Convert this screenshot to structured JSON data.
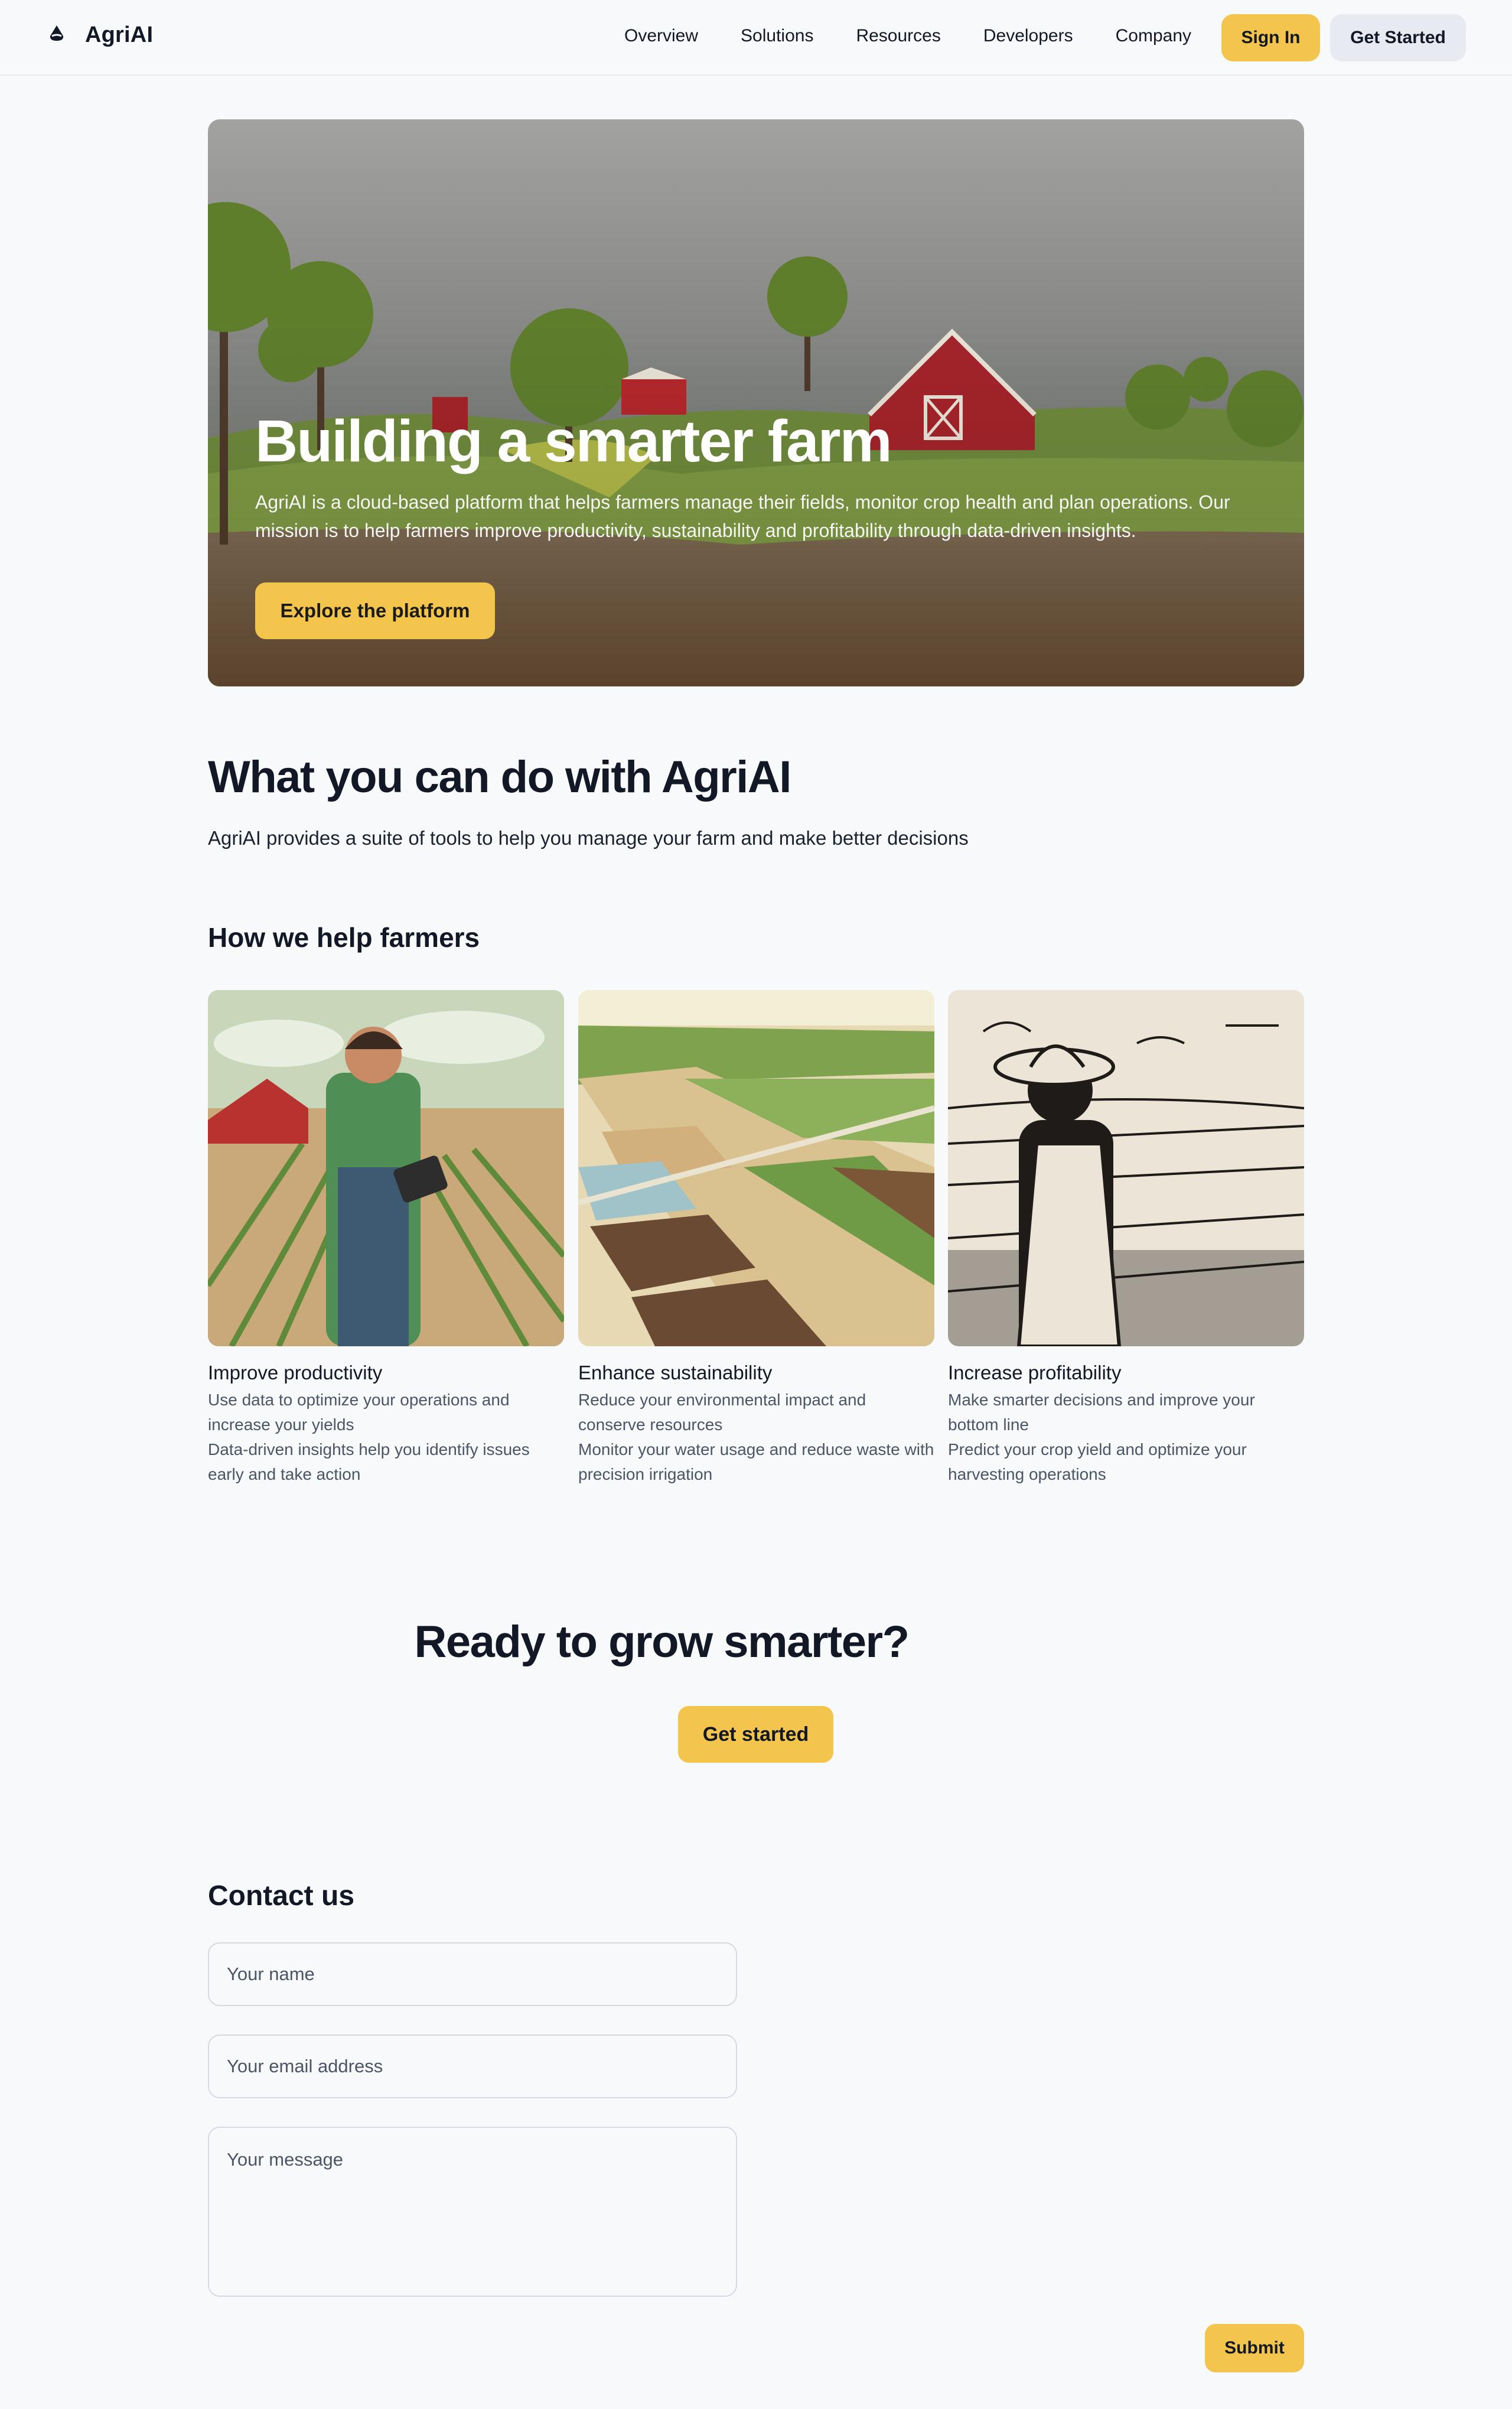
{
  "brand": {
    "name": "AgriAI",
    "logo_icon": "sprout-drop-icon"
  },
  "nav": {
    "links": [
      "Overview",
      "Solutions",
      "Resources",
      "Developers",
      "Company"
    ],
    "sign_in": "Sign In",
    "get_started": "Get Started"
  },
  "hero": {
    "title": "Building a smarter farm",
    "subtitle": "AgriAI is a cloud-based platform that helps farmers manage their fields, monitor crop health and plan operations. Our mission is to help farmers improve productivity, sustainability and profitability through data-driven insights.",
    "button": "Explore the platform"
  },
  "features": {
    "title": "What you can do with AgriAI",
    "lead": "AgriAI provides a suite of tools to help you manage your farm and make better decisions",
    "subtitle": "How we help farmers",
    "cards": [
      {
        "title": "Improve productivity",
        "lines": [
          "Use data to optimize your operations and increase your yields",
          "Data-driven insights help you identify issues early and take action"
        ]
      },
      {
        "title": "Enhance sustainability",
        "lines": [
          "Reduce your environmental impact and conserve resources",
          "Monitor your water usage and reduce waste with precision irrigation"
        ]
      },
      {
        "title": "Increase profitability",
        "lines": [
          "Make smarter decisions and improve your bottom line",
          "Predict your crop yield and optimize your harvesting operations"
        ]
      }
    ]
  },
  "cta": {
    "title": "Ready to grow smarter?",
    "button": "Get started"
  },
  "contact": {
    "title": "Contact us",
    "name_placeholder": "Your name",
    "email_placeholder": "Your email address",
    "message_placeholder": "Your message",
    "submit": "Submit"
  },
  "colors": {
    "accent": "#f4c54d",
    "background": "#f7f9fb",
    "text": "#121826",
    "muted": "#4b5566"
  }
}
